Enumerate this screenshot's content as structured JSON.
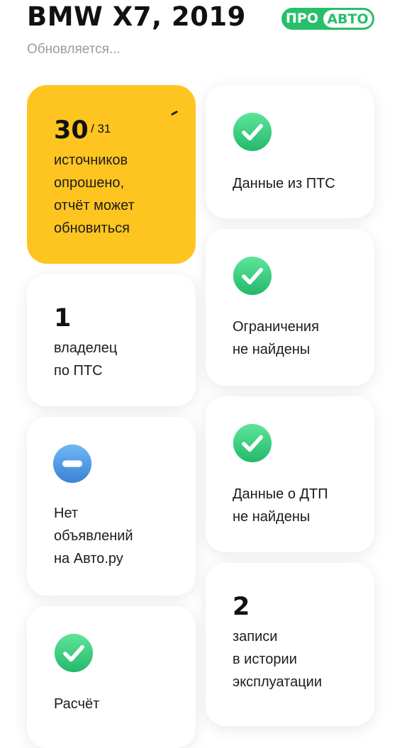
{
  "header": {
    "title": "BMW X7, 2019",
    "status": "Обновляется...",
    "logo": {
      "part1": "ПРО",
      "part2": "АВТО",
      "color": "#27bf6a"
    }
  },
  "cards": {
    "sources": {
      "count": "30",
      "total": "/ 31",
      "text": "источников\nопрошено,\nотчёт может\nобновиться",
      "color": "#fec521"
    },
    "pts_data": {
      "icon": "check-icon",
      "text": "Данные из ПТС"
    },
    "owners": {
      "count": "1",
      "text": "владелец\nпо ПТС"
    },
    "restrictions": {
      "icon": "check-icon",
      "text": "Ограничения\nне найдены"
    },
    "ads": {
      "icon": "minus-icon",
      "text": "Нет\nобъявлений\nна Авто.ру"
    },
    "accidents": {
      "icon": "check-icon",
      "text": "Данные о ДТП\nне найдены"
    },
    "service": {
      "count": "2",
      "text": "записи\nв истории\nэксплуатации"
    },
    "calculation": {
      "icon": "check-icon",
      "text": "Расчёт"
    }
  }
}
